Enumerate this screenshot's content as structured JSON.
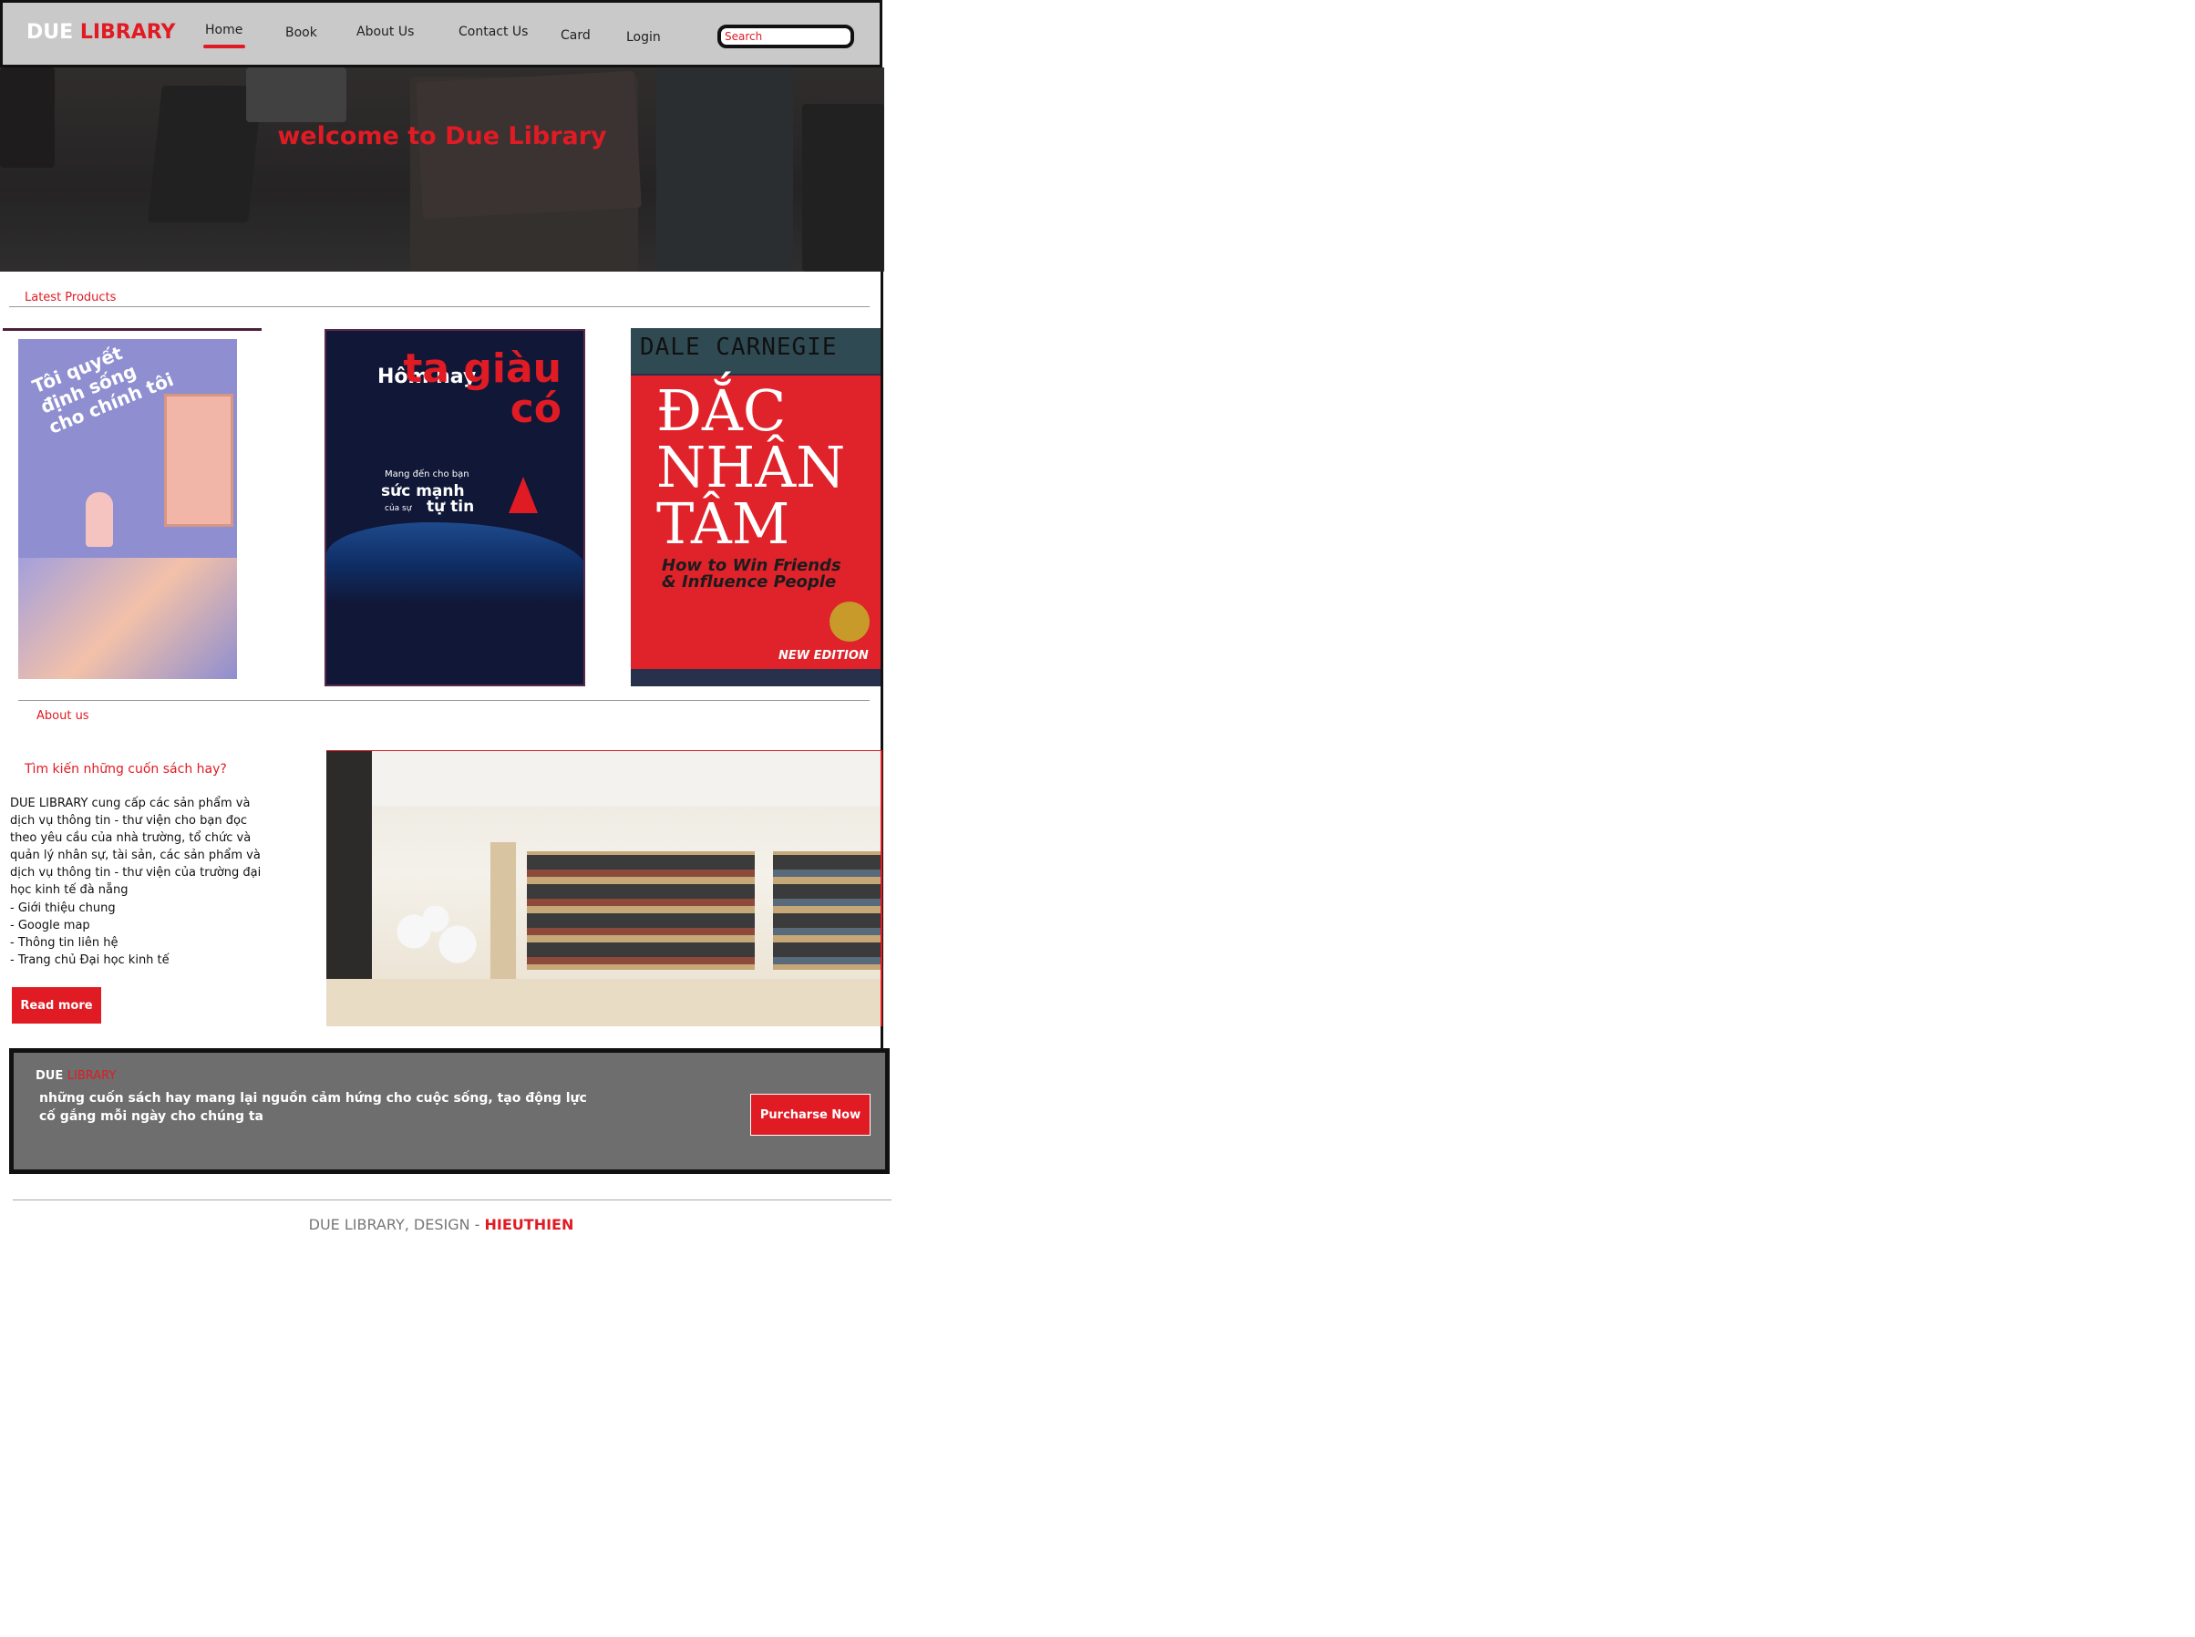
{
  "nav": {
    "brand_white": "DUE",
    "brand_red": "LIBRARY",
    "links": [
      "Home",
      "Book",
      "About Us",
      "Contact Us",
      "Card",
      "Login"
    ],
    "search_placeholder": "Search"
  },
  "hero": {
    "title": "welcome to Due Library"
  },
  "latest": {
    "heading": "Latest Products",
    "books": [
      {
        "title": "Tôi quyết định sống cho chính tôi"
      },
      {
        "title_small": "Hôm nay",
        "title_big": "ta giàu có",
        "subtitle_1": "Mang đến cho bạn",
        "subtitle_2": "sức mạnh",
        "subtitle_3": "của sự",
        "subtitle_4": "tự tin"
      },
      {
        "author": "DALE CARNEGIE",
        "line1": "ĐẮC",
        "line2": "NHÂN",
        "line3": "TÂM",
        "english": "How to Win Friends & Influence People",
        "badge": "NEW EDITION"
      }
    ]
  },
  "about": {
    "heading": "About us",
    "subheading": "Tìm kiến những cuốn sách hay?",
    "paragraph": "DUE LIBRARY cung cấp các sản phẩm và dịch vụ thông tin - thư viện cho bạn đọc theo yêu cầu của nhà trường, tổ chức và quản lý nhân sự, tài sản, các sản phẩm và dịch vụ thông tin - thư viện của trường đại học kinh tế đà nẵng",
    "list": [
      "- Giới thiệu chung",
      "- Google map",
      "- Thông tin liên hệ",
      "- Trang chủ Đại học kinh tế"
    ],
    "read_more": "Read more"
  },
  "cta": {
    "brand_white": "DUE",
    "brand_red": "LIBRARY",
    "text": "những cuốn sách hay mang lại nguồn cảm hứng cho cuộc sống, tạo động lực cố gắng mỗi ngày cho chúng ta",
    "button": "Purcharse Now"
  },
  "footer": {
    "text": "DUE LIBRARY, DESIGN - ",
    "highlight": "HIEUTHIEN"
  },
  "colors": {
    "accent": "#e01b24",
    "nav_bg": "#c9c9c9",
    "cta_bg": "#6e6e6e"
  }
}
